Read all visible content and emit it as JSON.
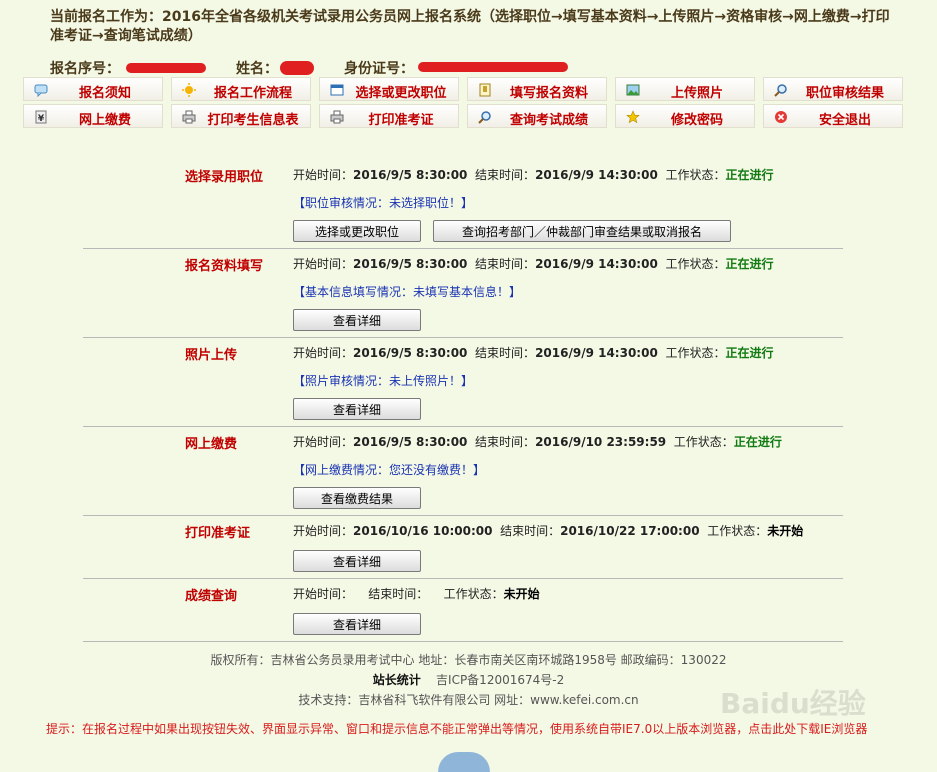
{
  "header": {
    "title": "当前报名工作为：2016年全省各级机关考试录用公务员网上报名系统（选择职位→填写基本资料→上传照片→资格审核→网上缴费→打印准考证→查询笔试成绩）",
    "reg_no_label": "报名序号：",
    "name_label": "姓名：",
    "id_label": "身份证号："
  },
  "nav": {
    "row1": [
      {
        "label": "报名须知",
        "icon": "notice-icon"
      },
      {
        "label": "报名工作流程",
        "icon": "flow-icon"
      },
      {
        "label": "选择或更改职位",
        "icon": "window-icon"
      },
      {
        "label": "填写报名资料",
        "icon": "form-icon"
      },
      {
        "label": "上传照片",
        "icon": "photo-icon"
      },
      {
        "label": "职位审核结果",
        "icon": "search-icon"
      }
    ],
    "row2": [
      {
        "label": "网上缴费",
        "icon": "yen-icon"
      },
      {
        "label": "打印考生信息表",
        "icon": "printer-icon"
      },
      {
        "label": "打印准考证",
        "icon": "printer-icon"
      },
      {
        "label": "查询考试成绩",
        "icon": "search-icon"
      },
      {
        "label": "修改密码",
        "icon": "star-icon"
      },
      {
        "label": "安全退出",
        "icon": "exit-icon"
      }
    ]
  },
  "labels": {
    "start": "开始时间：",
    "end": "结束时间：",
    "status": "工作状态："
  },
  "steps": [
    {
      "name": "选择录用职位",
      "start": "2016/9/5 8:30:00",
      "end": "2016/9/9 14:30:00",
      "status": "正在进行",
      "note": "【职位审核情况：未选择职位！】",
      "buttons": [
        "选择或更改职位",
        "查询招考部门／仲裁部门审查结果或取消报名"
      ]
    },
    {
      "name": "报名资料填写",
      "start": "2016/9/5 8:30:00",
      "end": "2016/9/9 14:30:00",
      "status": "正在进行",
      "note": "【基本信息填写情况：未填写基本信息！】",
      "buttons": [
        "查看详细"
      ]
    },
    {
      "name": "照片上传",
      "start": "2016/9/5 8:30:00",
      "end": "2016/9/9 14:30:00",
      "status": "正在进行",
      "note": "【照片审核情况：未上传照片！】",
      "buttons": [
        "查看详细"
      ]
    },
    {
      "name": "网上缴费",
      "start": "2016/9/5 8:30:00",
      "end": "2016/9/10 23:59:59",
      "status": "正在进行",
      "note": "【网上缴费情况：您还没有缴费！】",
      "buttons": [
        "查看缴费结果"
      ]
    },
    {
      "name": "打印准考证",
      "start": "2016/10/16 10:00:00",
      "end": "2016/10/22 17:00:00",
      "status": "未开始",
      "note": "",
      "buttons": [
        "查看详细"
      ]
    },
    {
      "name": "成绩查询",
      "start": "",
      "end": "",
      "status": "未开始",
      "note": "",
      "buttons": [
        "查看详细"
      ]
    }
  ],
  "footer": {
    "line1": "版权所有：吉林省公务员录用考试中心  地址：长春市南关区南环城路1958号   邮政编码：130022",
    "line2_stat": "站长统计",
    "line2_icp": "吉ICP备12001674号-2",
    "line3": "技术支持：吉林省科飞软件有限公司    网址：www.kefei.com.cn",
    "tip": "提示：在报名过程中如果出现按钮失效、界面显示异常、窗口和提示信息不能正常弹出等情况，使用系统自带IE7.0以上版本浏览器，点击此处下载IE浏览器"
  },
  "watermark": "Baidu经验",
  "colors": {
    "background": "#f4f9e6",
    "nav_label": "#c00000",
    "status_active": "#117a11",
    "note_blue": "#1a33b3",
    "tip_red": "#d81b1b"
  }
}
